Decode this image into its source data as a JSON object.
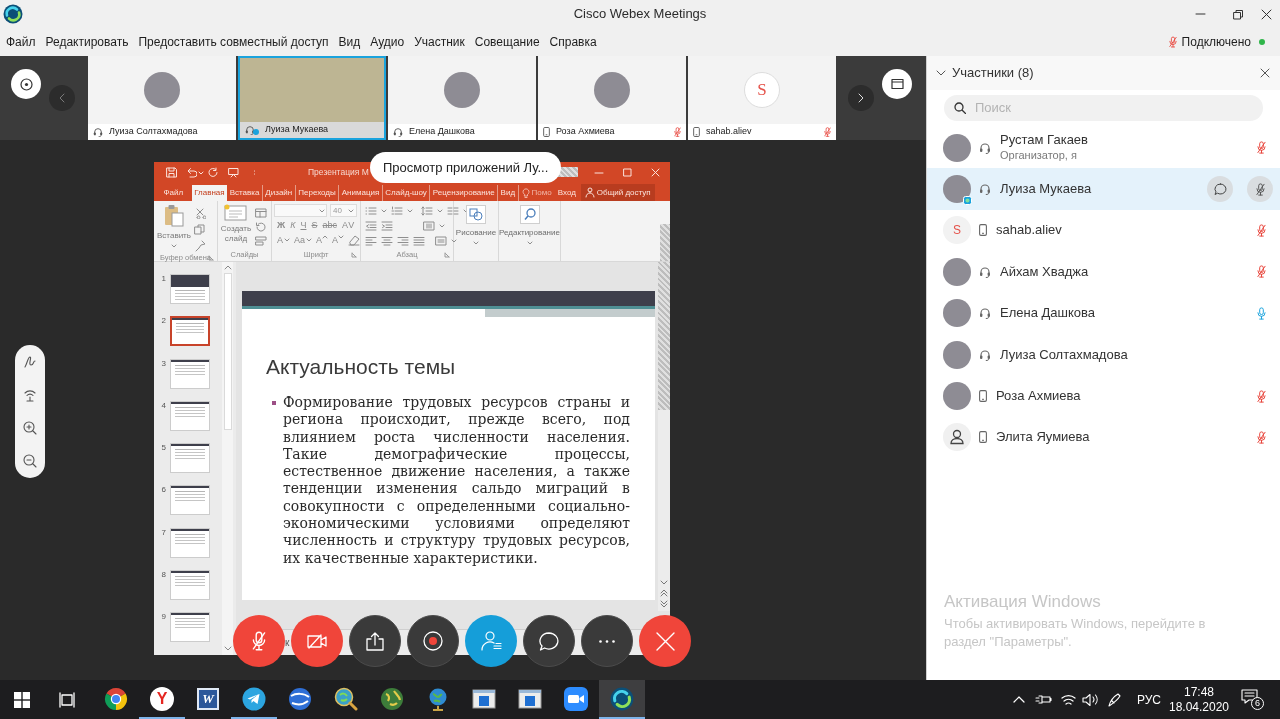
{
  "window": {
    "title": "Cisco Webex Meetings"
  },
  "menu": [
    "Файл",
    "Редактировать",
    "Предоставить совместный доступ",
    "Вид",
    "Аудио",
    "Участник",
    "Совещание",
    "Справка"
  ],
  "connection": {
    "muted": true,
    "label": "Подключено",
    "connected": true
  },
  "video_strip": [
    {
      "name": "Луиза Солтахмадова",
      "avatar": {
        "kind": "photo"
      },
      "audio": {
        "kind": "headset"
      },
      "muted": false,
      "presenter": false,
      "selected": false
    },
    {
      "name": "Луиза Мукаева",
      "avatar": {
        "kind": "video"
      },
      "audio": {
        "kind": "headset"
      },
      "muted": false,
      "presenter": true,
      "selected": true
    },
    {
      "name": "Елена Дашкова",
      "avatar": {
        "kind": "photo"
      },
      "audio": {
        "kind": "headset"
      },
      "muted": false,
      "presenter": false,
      "selected": false
    },
    {
      "name": "Роза Ахмиева",
      "avatar": {
        "kind": "photo"
      },
      "audio": {
        "kind": "phone"
      },
      "muted": true,
      "presenter": false,
      "selected": false
    },
    {
      "name": "sahab.aliev",
      "avatar": {
        "kind": "initial",
        "letter": "S"
      },
      "audio": {
        "kind": "phone"
      },
      "muted": true,
      "presenter": false,
      "selected": false
    }
  ],
  "sharing_label": "Просмотр приложений Лу...",
  "presentation": {
    "title": "Презентация М",
    "tabs": [
      {
        "label": "Файл",
        "selected": false
      },
      {
        "label": "Главная",
        "selected": true
      },
      {
        "label": "Вставка",
        "selected": false
      },
      {
        "label": "Дизайн",
        "selected": false
      },
      {
        "label": "Переходы",
        "selected": false
      },
      {
        "label": "Анимация",
        "selected": false
      },
      {
        "label": "Слайд-шоу",
        "selected": false
      },
      {
        "label": "Рецензирование",
        "selected": false
      },
      {
        "label": "Вид",
        "selected": false
      }
    ],
    "tell_me": "Помо",
    "sign_in": "Вход",
    "share": "Общий доступ",
    "ribbon": {
      "paste": "Вставить",
      "new_slide": "Создать слайд",
      "font_size": "40",
      "font_row_1": [
        "Ж",
        "К",
        "Ч",
        "S",
        "abc",
        "AV"
      ],
      "font_row_2": [
        "A",
        "Aa",
        "A",
        "A"
      ],
      "drawing": "Рисование",
      "editing": "Редактирование",
      "groups": [
        "Буфер обмена",
        "Слайды",
        "Шрифт",
        "Абзац"
      ]
    },
    "slides": [
      {
        "number": "1",
        "selected": false
      },
      {
        "number": "2",
        "selected": true
      },
      {
        "number": "3",
        "selected": false
      },
      {
        "number": "4",
        "selected": false
      },
      {
        "number": "5",
        "selected": false
      },
      {
        "number": "6",
        "selected": false
      },
      {
        "number": "7",
        "selected": false
      },
      {
        "number": "8",
        "selected": false
      },
      {
        "number": "9",
        "selected": false
      }
    ],
    "slide": {
      "title": "Актуальность темы",
      "bullets": [
        "Формирование трудовых ресурсов страны и региона происходит, прежде всего, под влиянием роста численности населения. Такие демографические процессы, естественное движение населения, а также тенденции изменения сальдо миграций в совокупности с определенными социально-экономическими условиями определяют численность и структуру трудовых ресурсов, их качественные характеристики."
      ]
    },
    "notes": "к"
  },
  "controls": [
    {
      "kind": "mute",
      "muted": true
    },
    {
      "kind": "video",
      "stopped": true
    },
    {
      "kind": "share"
    },
    {
      "kind": "record"
    },
    {
      "kind": "participants",
      "selected": true
    },
    {
      "kind": "chat",
      "selected": false
    },
    {
      "kind": "more"
    },
    {
      "kind": "leave"
    }
  ],
  "participants": {
    "title": "Участники (8)",
    "search_placeholder": "Поиск",
    "items": [
      {
        "name": "Рустам Гакаев",
        "role": "Организатор, я",
        "avatar": {
          "kind": "photo"
        },
        "audio": {
          "kind": "headset"
        },
        "muted": true,
        "speaking": false,
        "presenter": false,
        "selected": false
      },
      {
        "name": "Луиза Мукаева",
        "avatar": {
          "kind": "photo"
        },
        "audio": {
          "kind": "headset"
        },
        "muted": true,
        "speaking": false,
        "presenter": true,
        "selected": true
      },
      {
        "name": "sahab.aliev",
        "avatar": {
          "kind": "initial",
          "letter": "S"
        },
        "audio": {
          "kind": "phone"
        },
        "muted": true,
        "speaking": false,
        "presenter": false,
        "selected": false
      },
      {
        "name": "Айхам Хваджа",
        "avatar": {
          "kind": "photo"
        },
        "audio": {
          "kind": "headset"
        },
        "muted": true,
        "speaking": false,
        "presenter": false,
        "selected": false
      },
      {
        "name": "Елена Дашкова",
        "avatar": {
          "kind": "photo"
        },
        "audio": {
          "kind": "headset"
        },
        "muted": false,
        "speaking": true,
        "presenter": false,
        "selected": false
      },
      {
        "name": "Луиза Солтахмадова",
        "avatar": {
          "kind": "photo"
        },
        "audio": {
          "kind": "headset"
        },
        "muted": false,
        "speaking": false,
        "presenter": false,
        "selected": false
      },
      {
        "name": "Роза Ахмиева",
        "avatar": {
          "kind": "photo"
        },
        "audio": {
          "kind": "phone"
        },
        "muted": true,
        "speaking": false,
        "presenter": false,
        "selected": false
      },
      {
        "name": "Элита Яумиева",
        "avatar": {
          "kind": "generic"
        },
        "audio": {
          "kind": "phone"
        },
        "muted": true,
        "speaking": false,
        "presenter": false,
        "selected": false
      }
    ]
  },
  "activation": {
    "title": "Активация Windows",
    "text": "Чтобы активировать Windows, перейдите в раздел \"Параметры\"."
  },
  "taskbar": {
    "apps": [
      {
        "kind": "chrome",
        "running": false,
        "selected": false
      },
      {
        "kind": "yandex",
        "glyph": "Y",
        "running": true,
        "selected": false
      },
      {
        "kind": "word",
        "glyph": "W",
        "running": false,
        "selected": false
      },
      {
        "kind": "telegram",
        "running": true,
        "selected": false
      },
      {
        "kind": "earth",
        "running": false,
        "selected": false
      },
      {
        "kind": "globe_search",
        "running": false,
        "selected": false
      },
      {
        "kind": "globe_green",
        "running": false,
        "selected": false
      },
      {
        "kind": "globe_stand",
        "running": false,
        "selected": false
      },
      {
        "kind": "window",
        "running": false,
        "selected": false
      },
      {
        "kind": "window",
        "running": false,
        "selected": false
      },
      {
        "kind": "zoom",
        "running": false,
        "selected": false
      },
      {
        "kind": "webex",
        "running": true,
        "selected": true
      }
    ],
    "language": "РУС",
    "time": "17:48",
    "date": "18.04.2020",
    "notifications": "6"
  }
}
